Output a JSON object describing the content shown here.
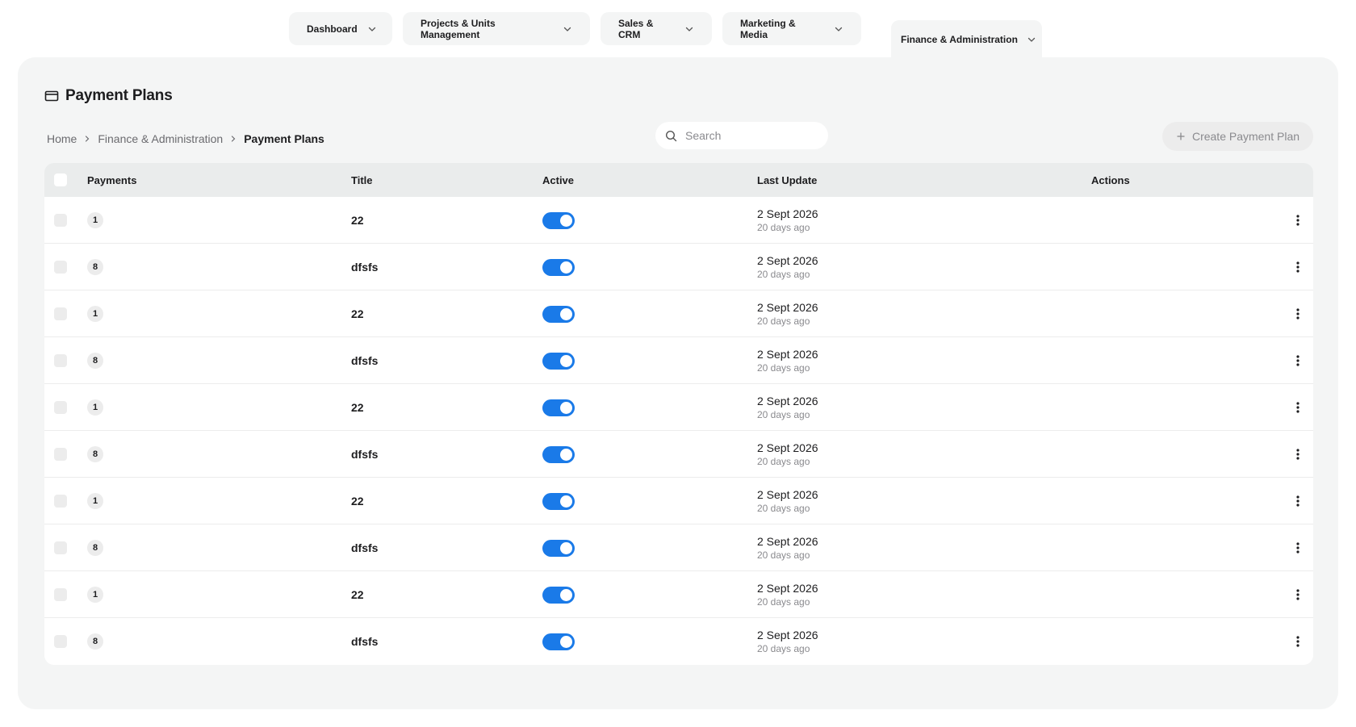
{
  "nav": {
    "tabs": [
      {
        "label": "Dashboard"
      },
      {
        "label": "Projects & Units Management"
      },
      {
        "label": "Sales & CRM"
      },
      {
        "label": "Marketing & Media"
      }
    ],
    "active_tab": "Finance & Administration"
  },
  "page": {
    "title": "Payment Plans",
    "title_icon": "credit-card-icon"
  },
  "breadcrumb": {
    "items": [
      "Home",
      "Finance & Administration",
      "Payment Plans"
    ]
  },
  "search": {
    "placeholder": "Search",
    "value": ""
  },
  "toolbar": {
    "create_label": "Create Payment Plan"
  },
  "table": {
    "columns": {
      "payments": "Payments",
      "title": "Title",
      "active": "Active",
      "last_update": "Last Update",
      "actions": "Actions"
    },
    "rows": [
      {
        "payments": "1",
        "title": "22",
        "active": true,
        "date": "2 Sept 2026",
        "ago": "20 days ago"
      },
      {
        "payments": "8",
        "title": "dfsfs",
        "active": true,
        "date": "2 Sept 2026",
        "ago": "20 days ago"
      },
      {
        "payments": "1",
        "title": "22",
        "active": true,
        "date": "2 Sept 2026",
        "ago": "20 days ago"
      },
      {
        "payments": "8",
        "title": "dfsfs",
        "active": true,
        "date": "2 Sept 2026",
        "ago": "20 days ago"
      },
      {
        "payments": "1",
        "title": "22",
        "active": true,
        "date": "2 Sept 2026",
        "ago": "20 days ago"
      },
      {
        "payments": "8",
        "title": "dfsfs",
        "active": true,
        "date": "2 Sept 2026",
        "ago": "20 days ago"
      },
      {
        "payments": "1",
        "title": "22",
        "active": true,
        "date": "2 Sept 2026",
        "ago": "20 days ago"
      },
      {
        "payments": "8",
        "title": "dfsfs",
        "active": true,
        "date": "2 Sept 2026",
        "ago": "20 days ago"
      },
      {
        "payments": "1",
        "title": "22",
        "active": true,
        "date": "2 Sept 2026",
        "ago": "20 days ago"
      },
      {
        "payments": "8",
        "title": "dfsfs",
        "active": true,
        "date": "2 Sept 2026",
        "ago": "20 days ago"
      }
    ]
  },
  "colors": {
    "toggle_on": "#1a7ae8",
    "panel_bg": "#f4f5f5",
    "header_bg": "#eaecec"
  }
}
